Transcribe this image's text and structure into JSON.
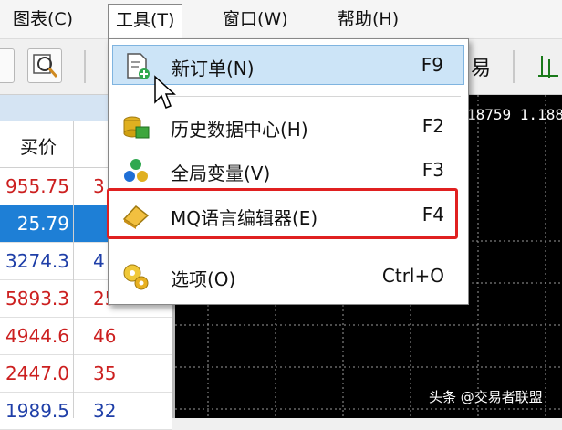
{
  "menubar": {
    "items": [
      {
        "label": "图表(C)"
      },
      {
        "label": "工具(T)"
      },
      {
        "label": "窗口(W)"
      },
      {
        "label": "帮助(H)"
      }
    ]
  },
  "toolbar": {
    "partial_label": "易"
  },
  "market_watch": {
    "column_bid": "买价",
    "rows": [
      {
        "bid": "955.75",
        "ask": "3",
        "color": "red"
      },
      {
        "bid": "25.79",
        "ask": "",
        "color": "selected"
      },
      {
        "bid": "3274.3",
        "ask": "4",
        "color": "blue"
      },
      {
        "bid": "5893.3",
        "ask": "25",
        "color": "red"
      },
      {
        "bid": "4944.6",
        "ask": "46",
        "color": "red"
      },
      {
        "bid": "2447.0",
        "ask": "35",
        "color": "red"
      },
      {
        "bid": "1989.5",
        "ask": "32",
        "color": "blue"
      }
    ]
  },
  "chart": {
    "price_text": "18759 1.188"
  },
  "tools_menu": {
    "items": [
      {
        "label": "新订单(N)",
        "shortcut": "F9",
        "icon": "new-order-icon"
      },
      {
        "label": "历史数据中心(H)",
        "shortcut": "F2",
        "icon": "history-center-icon"
      },
      {
        "label": "全局变量(V)",
        "shortcut": "F3",
        "icon": "global-variables-icon"
      },
      {
        "label": "MQ语言编辑器(E)",
        "shortcut": "F4",
        "icon": "metaeditor-icon"
      },
      {
        "label": "选项(O)",
        "shortcut": "Ctrl+O",
        "icon": "options-icon"
      }
    ]
  },
  "watermark": "头条 @交易者联盟",
  "colors": {
    "highlight": "#e02020",
    "selected_row": "#1e7fd6",
    "menu_hover": "#cce4f7"
  }
}
